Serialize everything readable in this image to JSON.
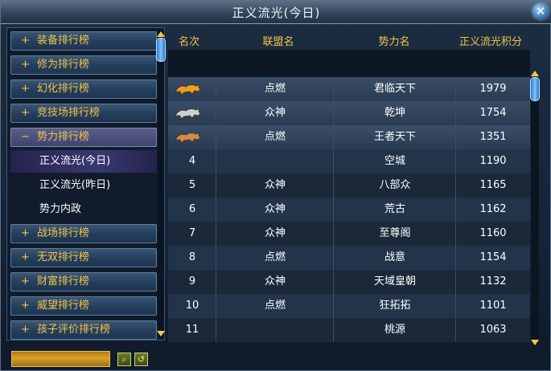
{
  "window": {
    "title": "正义流光(今日)"
  },
  "sidebar": {
    "categories_top": [
      {
        "label": "装备排行榜",
        "sign": "+"
      },
      {
        "label": "修为排行榜",
        "sign": "+"
      },
      {
        "label": "幻化排行榜",
        "sign": "+"
      },
      {
        "label": "竞技场排行榜",
        "sign": "+"
      }
    ],
    "open_category": {
      "label": "势力排行榜",
      "sign": "−"
    },
    "sub_items": [
      {
        "label": "正义流光(今日)"
      },
      {
        "label": "正义流光(昨日)"
      },
      {
        "label": "势力内政"
      }
    ],
    "categories_bottom": [
      {
        "label": "战场排行榜",
        "sign": "+"
      },
      {
        "label": "无双排行榜",
        "sign": "+"
      },
      {
        "label": "财富排行榜",
        "sign": "+"
      },
      {
        "label": "威望排行榜",
        "sign": "+"
      },
      {
        "label": "孩子评价排行榜",
        "sign": "+"
      }
    ]
  },
  "table": {
    "headers": [
      "名次",
      "联盟名",
      "势力名",
      "正义流光积分"
    ],
    "rows": [
      {
        "rank": "",
        "rank_icon": "gold-beast-icon",
        "alliance": "点燃",
        "faction": "君临天下",
        "score": "1979"
      },
      {
        "rank": "",
        "rank_icon": "silver-beast-icon",
        "alliance": "众神",
        "faction": "乾坤",
        "score": "1754"
      },
      {
        "rank": "",
        "rank_icon": "bronze-beast-icon",
        "alliance": "点燃",
        "faction": "王者天下",
        "score": "1351"
      },
      {
        "rank": "4",
        "rank_icon": "",
        "alliance": "",
        "faction": "空城",
        "score": "1190"
      },
      {
        "rank": "5",
        "rank_icon": "",
        "alliance": "众神",
        "faction": "八部众",
        "score": "1165"
      },
      {
        "rank": "6",
        "rank_icon": "",
        "alliance": "众神",
        "faction": "荒古",
        "score": "1162"
      },
      {
        "rank": "7",
        "rank_icon": "",
        "alliance": "众神",
        "faction": "至尊阁",
        "score": "1160"
      },
      {
        "rank": "8",
        "rank_icon": "",
        "alliance": "点燃",
        "faction": "战意",
        "score": "1154"
      },
      {
        "rank": "9",
        "rank_icon": "",
        "alliance": "众神",
        "faction": "天域皇朝",
        "score": "1132"
      },
      {
        "rank": "10",
        "rank_icon": "",
        "alliance": "点燃",
        "faction": "狂拓拓",
        "score": "1101"
      },
      {
        "rank": "11",
        "rank_icon": "",
        "alliance": "",
        "faction": "桃源",
        "score": "1063"
      }
    ]
  },
  "bottom": {
    "search_value": "",
    "search_icon": "search-icon",
    "reset_icon": "refresh-icon"
  },
  "colors": {
    "accent": "#f3c34a",
    "title_text": "#eef3f8",
    "panel": "#16243a",
    "gold": "#e8a020",
    "silver": "#c8d0d8",
    "bronze": "#d08a4a"
  }
}
